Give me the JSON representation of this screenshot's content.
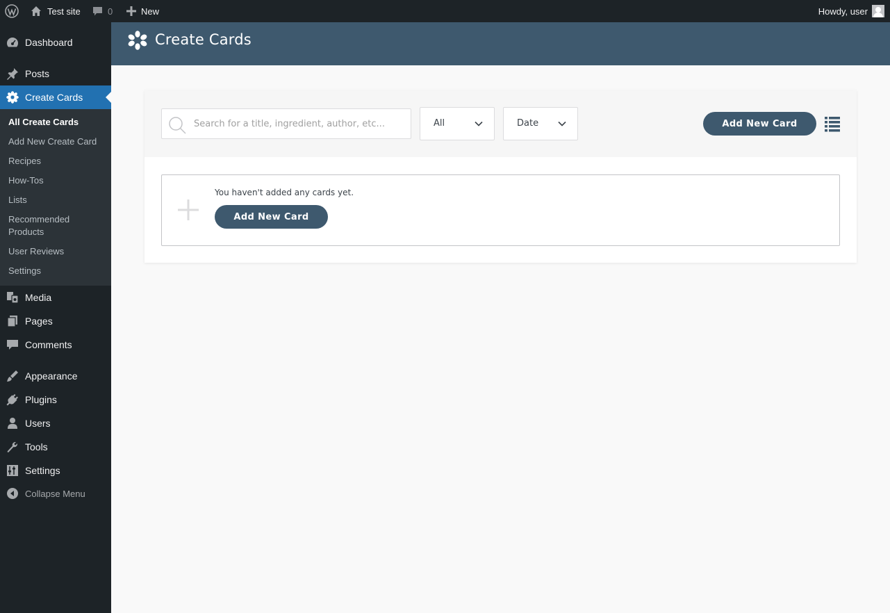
{
  "admin_bar": {
    "site_name": "Test site",
    "comments_count": "0",
    "new_label": "New",
    "greeting": "Howdy, user"
  },
  "sidebar": {
    "items": [
      {
        "label": "Dashboard",
        "icon": "dashboard-icon"
      },
      {
        "label": "Posts",
        "icon": "pin-icon"
      },
      {
        "label": "Create Cards",
        "icon": "flower-icon"
      },
      {
        "label": "Media",
        "icon": "media-icon"
      },
      {
        "label": "Pages",
        "icon": "pages-icon"
      },
      {
        "label": "Comments",
        "icon": "comment-icon"
      },
      {
        "label": "Appearance",
        "icon": "brush-icon"
      },
      {
        "label": "Plugins",
        "icon": "plug-icon"
      },
      {
        "label": "Users",
        "icon": "user-icon"
      },
      {
        "label": "Tools",
        "icon": "wrench-icon"
      },
      {
        "label": "Settings",
        "icon": "sliders-icon"
      }
    ],
    "submenu": [
      "All Create Cards",
      "Add New Create Card",
      "Recipes",
      "How-Tos",
      "Lists",
      "Recommended Products",
      "User Reviews",
      "Settings"
    ],
    "collapse_label": "Collapse Menu"
  },
  "header": {
    "title": "Create Cards"
  },
  "toolbar": {
    "search_placeholder": "Search for a title, ingredient, author, etc...",
    "type_filter": "All",
    "sort_filter": "Date",
    "add_button": "Add New Card"
  },
  "empty_state": {
    "message": "You haven't added any cards yet.",
    "add_button": "Add New Card"
  },
  "colors": {
    "accent": "#2271b1",
    "header_band": "#3e596e",
    "sidebar": "#1d2327"
  }
}
